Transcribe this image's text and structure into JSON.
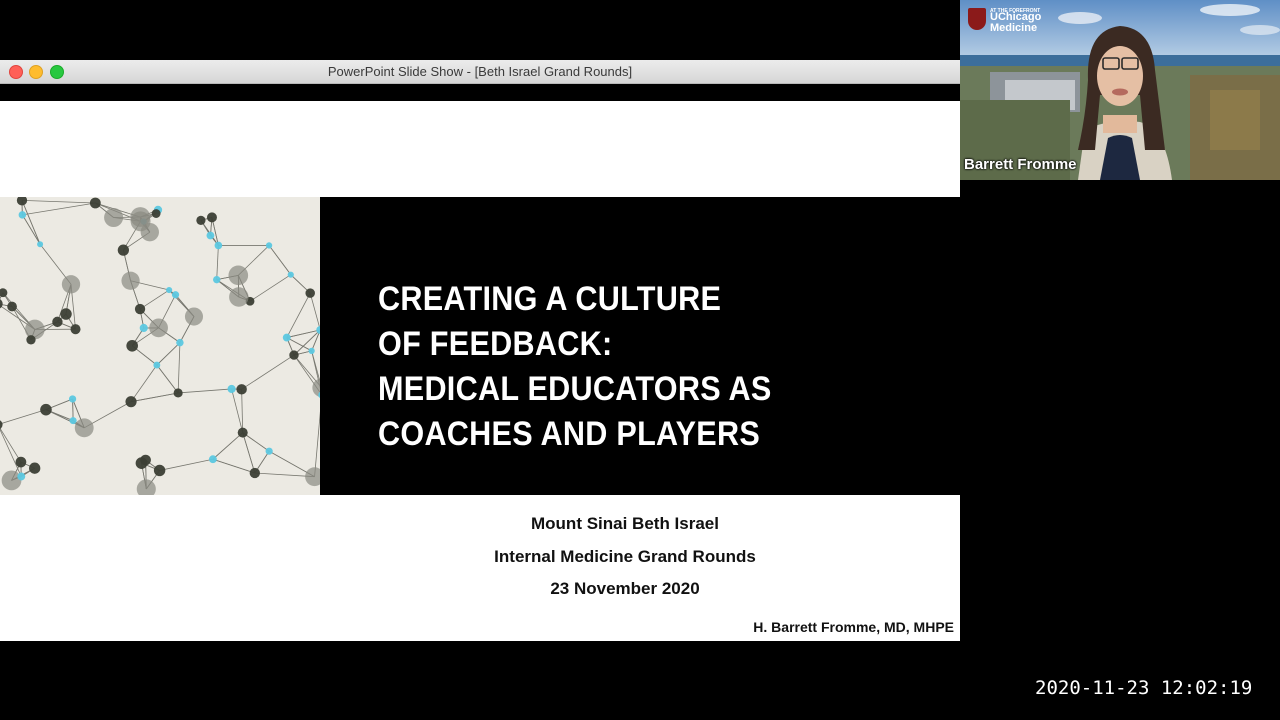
{
  "window": {
    "title": "PowerPoint Slide Show - [Beth Israel Grand Rounds]"
  },
  "slide": {
    "title_lines": [
      "CREATING A CULTURE",
      "OF FEEDBACK:",
      "MEDICAL EDUCATORS AS",
      "COACHES AND PLAYERS"
    ],
    "venue": "Mount Sinai Beth Israel",
    "event": "Internal Medicine Grand Rounds",
    "date": "23 November 2020",
    "author": "H. Barrett Fromme, MD, MHPE"
  },
  "video": {
    "participant_name": "Barrett Fromme",
    "logo_small": "AT THE FOREFRONT",
    "logo_line1": "UChicago",
    "logo_line2": "Medicine"
  },
  "timestamp": "2020-11-23 12:02:19",
  "colors": {
    "close": "#ff5f57",
    "minimize": "#febc2e",
    "maximize": "#28c840",
    "network_cyan": "#5cc8e0",
    "network_gray": "#8a8a82"
  }
}
